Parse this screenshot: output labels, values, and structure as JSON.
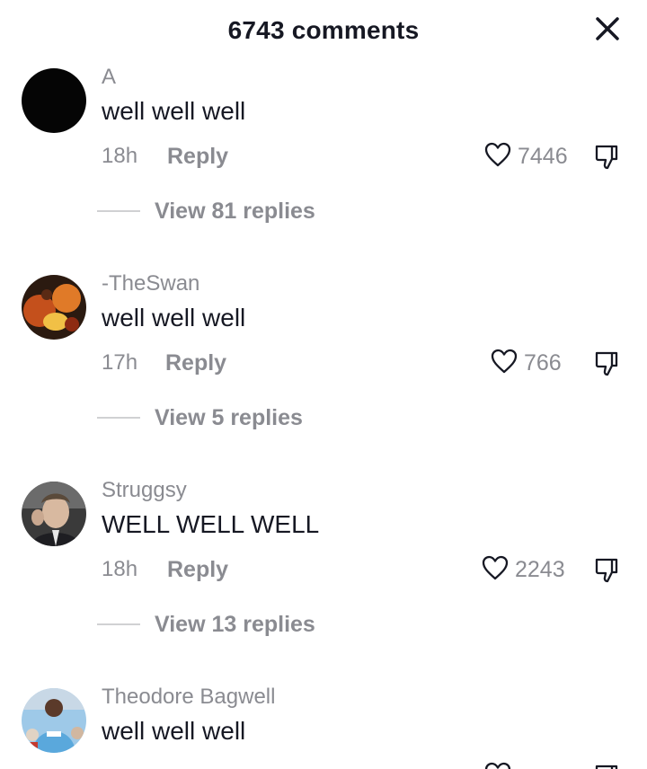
{
  "header": {
    "title": "6743 comments",
    "close_icon": "close-icon"
  },
  "comments": [
    {
      "username": "A",
      "text": "well well well",
      "time": "18h",
      "reply_label": "Reply",
      "likes": "7446",
      "view_replies": "View 81 replies"
    },
    {
      "username": "-TheSwan",
      "text": "well well well",
      "time": "17h",
      "reply_label": "Reply",
      "likes": "766",
      "view_replies": "View 5 replies"
    },
    {
      "username": "Struggsy",
      "text": "WELL WELL WELL",
      "time": "18h",
      "reply_label": "Reply",
      "likes": "2243",
      "view_replies": "View 13 replies"
    },
    {
      "username": "Theodore Bagwell",
      "text": "well well well"
    }
  ],
  "colors": {
    "primary_text": "#161823",
    "secondary_text": "#8a8b91"
  }
}
